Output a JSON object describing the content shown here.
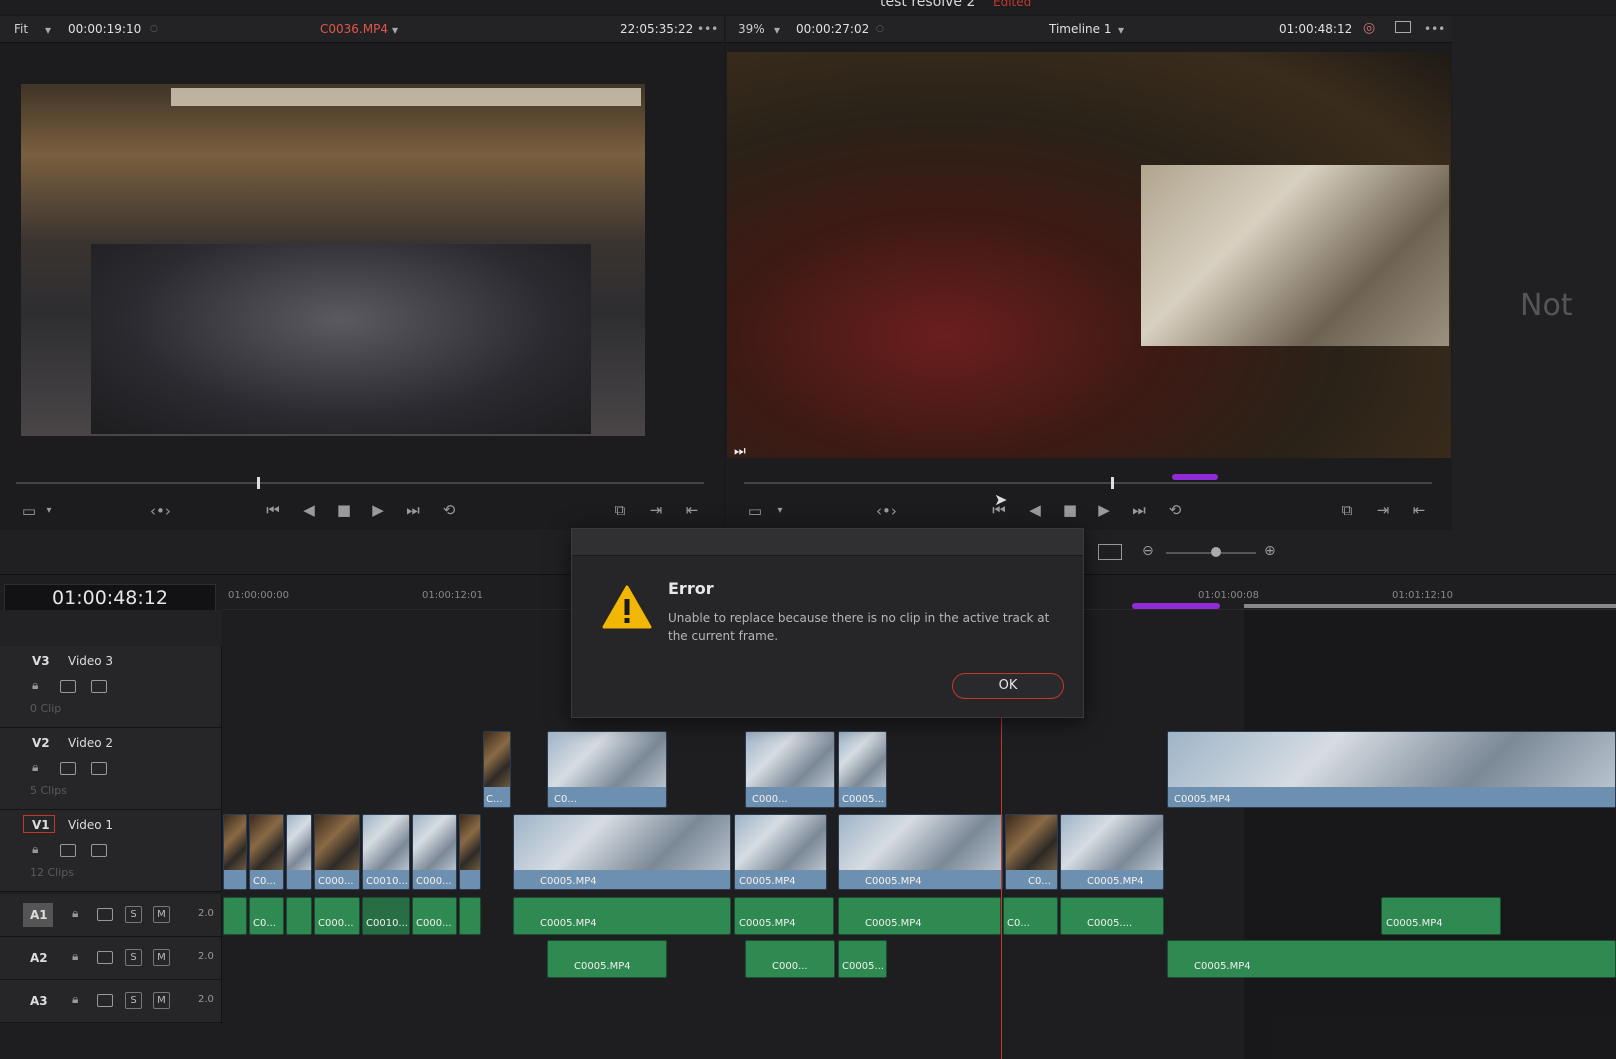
{
  "project": {
    "title": "test resolve 2",
    "status": "Edited"
  },
  "source_viewer": {
    "zoom": "Fit",
    "duration": "00:00:19:10",
    "clip_name": "C0036.MP4",
    "timecode": "22:05:35:22",
    "more": "•••"
  },
  "timeline_viewer": {
    "zoom": "39%",
    "duration": "00:00:27:02",
    "timeline_name": "Timeline 1",
    "timecode": "01:00:48:12",
    "more": "•••"
  },
  "side_panel": {
    "text": "Not"
  },
  "timeline": {
    "current_timecode": "01:00:48:12",
    "ruler": [
      "01:00:00:00",
      "01:00:12:01",
      "01:01:00:08",
      "01:01:12:10"
    ],
    "video_tracks": [
      {
        "id": "V3",
        "name": "Video 3",
        "count": "0 Clip"
      },
      {
        "id": "V2",
        "name": "Video 2",
        "count": "5 Clips"
      },
      {
        "id": "V1",
        "name": "Video 1",
        "count": "12 Clips"
      }
    ],
    "audio_tracks": [
      {
        "id": "A1",
        "level": "2.0",
        "solo": "S",
        "mute": "M"
      },
      {
        "id": "A2",
        "level": "2.0",
        "solo": "S",
        "mute": "M"
      },
      {
        "id": "A3",
        "level": "2.0",
        "solo": "S",
        "mute": "M"
      }
    ],
    "v2_clips": [
      "C...",
      "C0...",
      "C000...",
      "C0005...",
      "C0005.MP4"
    ],
    "v1_clips": [
      "C0...",
      "C000...",
      "C0010...",
      "C000...",
      "C0005.MP4",
      "C0005.MP4",
      "C0005.MP4",
      "C0...",
      "C0005.MP4"
    ],
    "a1_clips": [
      "C0...",
      "C000...",
      "C0010...",
      "C000...",
      "C0005.MP4",
      "C0005.MP4",
      "C0005.MP4",
      "C0...",
      "C0005....",
      "C0005.MP4"
    ],
    "a2_clips": [
      "C0005.MP4",
      "C000...",
      "C0005...",
      "C0005.MP4"
    ]
  },
  "dialog": {
    "title": "Error",
    "message": "Unable to replace because there is no clip in the active track at the current frame.",
    "ok_label": "OK"
  },
  "colors": {
    "accent_red": "#c0392b",
    "video_clip": "#6d8fb0",
    "audio_clip": "#2f8a52",
    "range_purple": "#8e2bd6"
  }
}
